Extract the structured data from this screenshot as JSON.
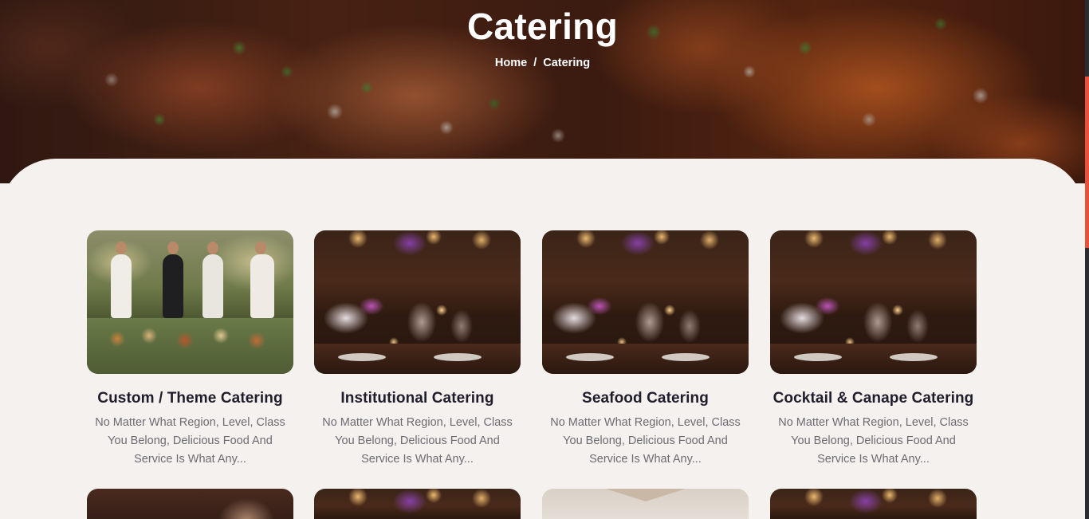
{
  "hero": {
    "title": "Catering",
    "breadcrumb": [
      "Home",
      "/",
      "Catering"
    ]
  },
  "cards": [
    {
      "title": "Custom / Theme Catering",
      "description": "No Matter What Region, Level, Class You Belong, Delicious Food And Service Is What Any...",
      "image": "outdoor-catering-photo"
    },
    {
      "title": "Institutional Catering",
      "description": "No Matter What Region, Level, Class You Belong, Delicious Food And Service Is What Any...",
      "image": "dining-table-photo"
    },
    {
      "title": "Seafood Catering",
      "description": "No Matter What Region, Level, Class You Belong, Delicious Food And Service Is What Any...",
      "image": "dining-table-photo"
    },
    {
      "title": "Cocktail & Canape Catering",
      "description": "No Matter What Region, Level, Class You Belong, Delicious Food And Service Is What Any...",
      "image": "dining-table-photo"
    }
  ],
  "colors": {
    "page_background": "#f5f1ee",
    "title_text": "#1f1d2b",
    "description_text": "#6b6b72",
    "scroll_accent": "#e8523a"
  }
}
